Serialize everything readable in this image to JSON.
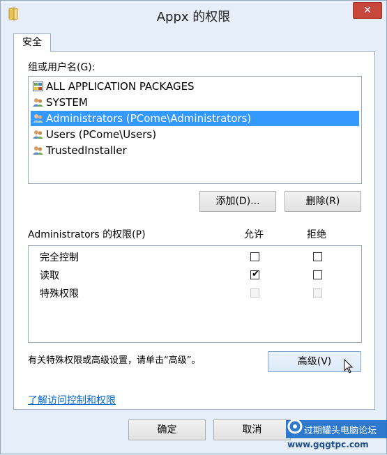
{
  "window": {
    "title": "Appx 的权限",
    "close_label": "✕"
  },
  "tab": {
    "label": "安全"
  },
  "groups": {
    "label": "组或用户名(G):",
    "items": [
      {
        "label": "ALL APPLICATION PACKAGES",
        "icon": "packages-icon",
        "selected": false
      },
      {
        "label": "SYSTEM",
        "icon": "users-icon",
        "selected": false
      },
      {
        "label": "Administrators (PCome\\Administrators)",
        "icon": "users-icon",
        "selected": true
      },
      {
        "label": "Users (PCome\\Users)",
        "icon": "users-icon",
        "selected": false
      },
      {
        "label": "TrustedInstaller",
        "icon": "users-icon",
        "selected": false
      }
    ]
  },
  "buttons": {
    "add": "添加(D)...",
    "remove": "删除(R)",
    "advanced": "高级(V)",
    "ok": "确定",
    "cancel": "取消"
  },
  "permissions": {
    "header": "Administrators 的权限(P)",
    "allow_label": "允许",
    "deny_label": "拒绝",
    "rows": [
      {
        "label": "完全控制",
        "allow": false,
        "deny": false,
        "disabled": false
      },
      {
        "label": "读取",
        "allow": true,
        "deny": false,
        "disabled": false
      },
      {
        "label": "特殊权限",
        "allow": false,
        "deny": false,
        "disabled": true
      }
    ]
  },
  "advanced_text": "有关特殊权限或高级设置，请单击“高级”。",
  "learn_link": "了解访问控制和权限",
  "watermark": {
    "line1": "过期罐头电脑论坛",
    "line2": "www.gqgtpc.com"
  }
}
